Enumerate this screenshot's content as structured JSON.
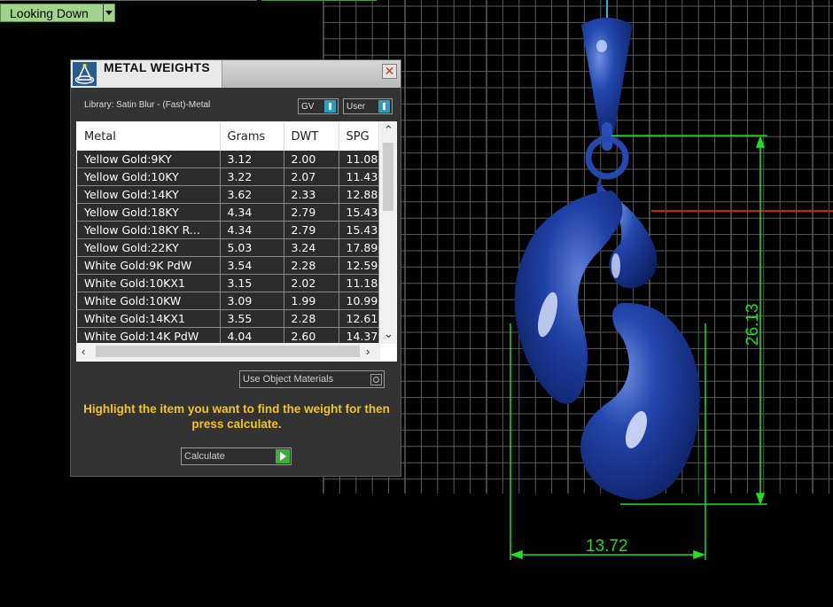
{
  "view": {
    "label": "Looking Down"
  },
  "dialog": {
    "title": "METAL WEIGHTS",
    "close": "✕",
    "library": "Library: Satin Blur - (Fast)-Metal",
    "toggle_gv": "GV",
    "toggle_user": "User",
    "columns": [
      "Metal",
      "Grams",
      "DWT",
      "SPG"
    ],
    "rows": [
      [
        "Yellow Gold:9KY",
        "3.12",
        "2.00",
        "11.08"
      ],
      [
        "Yellow Gold:10KY",
        "3.22",
        "2.07",
        "11.43"
      ],
      [
        "Yellow Gold:14KY",
        "3.62",
        "2.33",
        "12.88"
      ],
      [
        "Yellow Gold:18KY",
        "4.34",
        "2.79",
        "15.43"
      ],
      [
        "Yellow Gold:18KY R...",
        "4.34",
        "2.79",
        "15.43"
      ],
      [
        "Yellow Gold:22KY",
        "5.03",
        "3.24",
        "17.89"
      ],
      [
        "White Gold:9K PdW",
        "3.54",
        "2.28",
        "12.59"
      ],
      [
        "White Gold:10KX1",
        "3.15",
        "2.02",
        "11.18"
      ],
      [
        "White Gold:10KW",
        "3.09",
        "1.99",
        "10.99"
      ],
      [
        "White Gold:14KX1",
        "3.55",
        "2.28",
        "12.61"
      ],
      [
        "White Gold:14K PdW",
        "4.04",
        "2.60",
        "14.37"
      ]
    ],
    "use_object_materials": "Use Object Materials",
    "hint": "Highlight the item you want to find the weight for then press calculate.",
    "calculate": "Calculate"
  },
  "dimensions": {
    "height": "26.13",
    "width": "13.72"
  },
  "colors": {
    "dimension": "#22dd22",
    "pendant": "#1a3fa0",
    "hint": "#f5c518"
  }
}
